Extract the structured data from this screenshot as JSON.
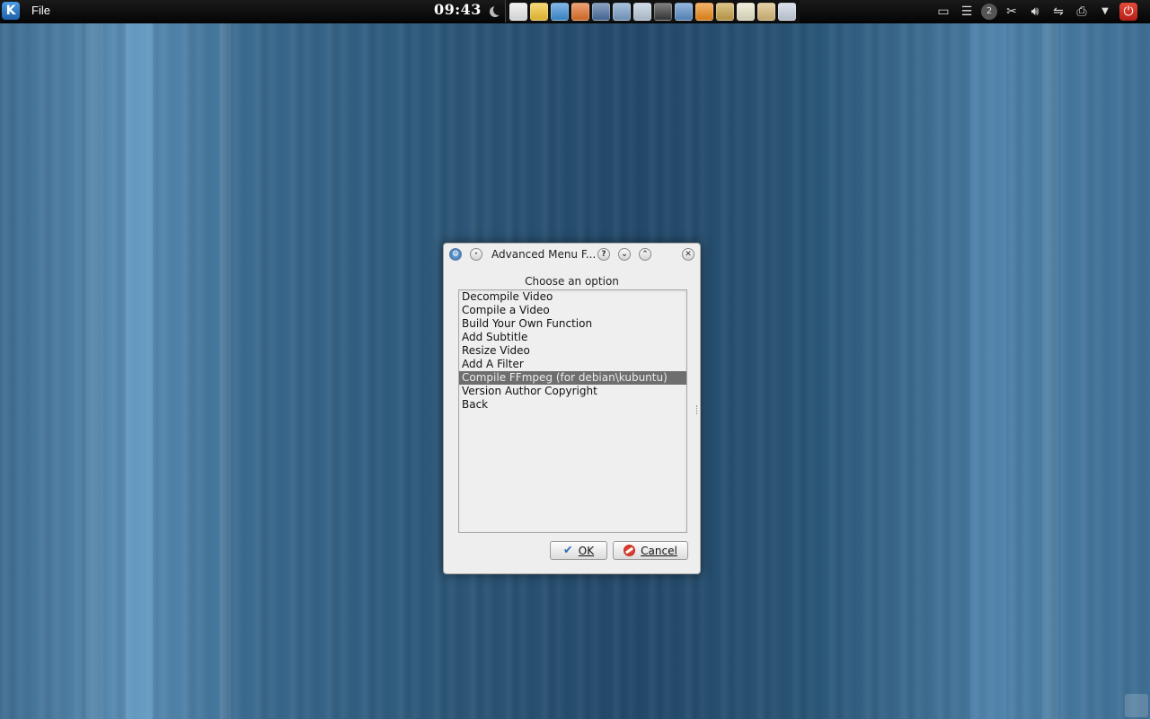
{
  "panel": {
    "menu_label": "File",
    "clock": "09:43",
    "launchers": [
      {
        "icon": "files-icon",
        "color": "#e9e9e9"
      },
      {
        "icon": "favorites-star-icon",
        "color": "#f2c232"
      },
      {
        "icon": "network-icon",
        "color": "#3f8fd6"
      },
      {
        "icon": "firefox-icon",
        "color": "#e2702a"
      },
      {
        "icon": "chat-icon",
        "color": "#4a6fa0"
      },
      {
        "icon": "calendar-icon",
        "color": "#7a9fc8"
      },
      {
        "icon": "notes-icon",
        "color": "#b9c9da"
      },
      {
        "icon": "terminal-icon",
        "color": "#3a3a3a"
      },
      {
        "icon": "remote-desktop-icon",
        "color": "#5b8fc8"
      },
      {
        "icon": "vlc-icon",
        "color": "#ee8a1a"
      },
      {
        "icon": "tools-icon",
        "color": "#c8a24a"
      },
      {
        "icon": "document-icon",
        "color": "#e8e4c8"
      },
      {
        "icon": "package-icon",
        "color": "#d8b878"
      },
      {
        "icon": "accessibility-icon",
        "color": "#c8d0e0"
      }
    ],
    "tray_badge": "2"
  },
  "dialog": {
    "title": "Advanced Menu F...",
    "prompt": "Choose an option",
    "items": [
      "Decompile Video",
      "Compile a Video",
      "Build Your Own Function",
      "Add Subtitle",
      "Resize Video",
      "Add A Filter",
      "Compile FFmpeg (for debian\\kubuntu)",
      "Version Author Copyright",
      "Back"
    ],
    "selected_index": 6,
    "ok_label": "OK",
    "cancel_label": "Cancel"
  }
}
